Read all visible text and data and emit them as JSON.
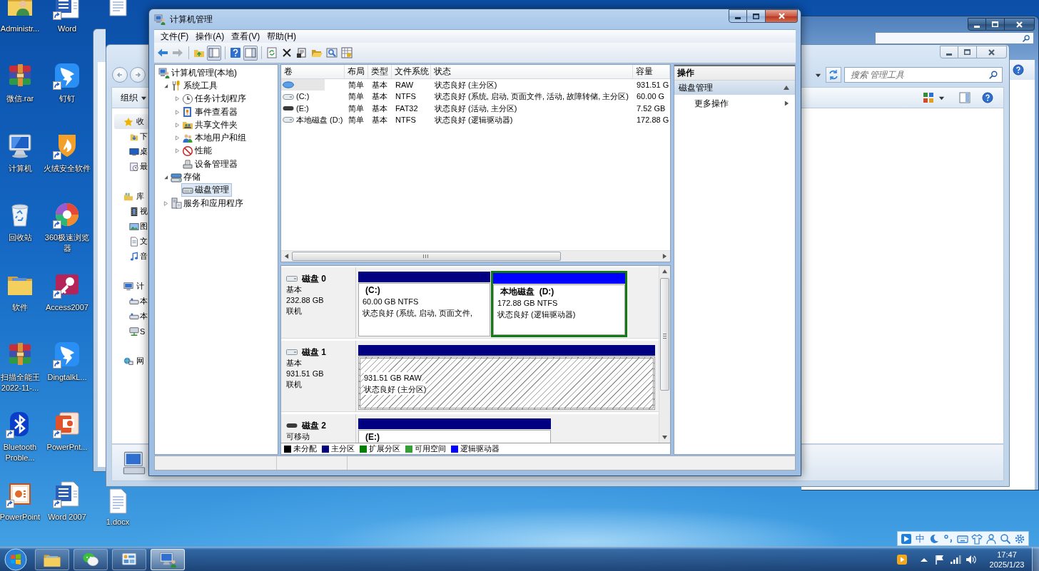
{
  "desktop": {
    "icons": [
      {
        "label": "Administr...",
        "kind": "user-folder",
        "shortcut": false
      },
      {
        "label": "Word",
        "kind": "word",
        "shortcut": true
      },
      {
        "label": "微信.rar",
        "kind": "archive",
        "shortcut": false
      },
      {
        "label": "钉钉",
        "kind": "dingtalk",
        "shortcut": true
      },
      {
        "label": "计算机",
        "kind": "computer",
        "shortcut": false
      },
      {
        "label": "火绒安全软件",
        "kind": "shield",
        "shortcut": true
      },
      {
        "label": "回收站",
        "kind": "recycle",
        "shortcut": false
      },
      {
        "label": "360极速浏览器",
        "kind": "browser",
        "shortcut": true
      },
      {
        "label": "软件",
        "kind": "folder",
        "shortcut": false
      },
      {
        "label": "Access2007",
        "kind": "access",
        "shortcut": true
      },
      {
        "label": "扫描全能王 2022-11-...",
        "kind": "archive",
        "shortcut": false
      },
      {
        "label": "DingtalkL...",
        "kind": "dingtalk",
        "shortcut": true
      },
      {
        "label": "Bluetooth Proble...",
        "kind": "bluetooth",
        "shortcut": true
      },
      {
        "label": "PowerPnt...",
        "kind": "powerpoint",
        "shortcut": true
      },
      {
        "label": "PowerPoint",
        "kind": "slides",
        "shortcut": true
      },
      {
        "label": "Word 2007",
        "kind": "word",
        "shortcut": true
      }
    ],
    "loose_icons": [
      {
        "kind": "document",
        "label": "1.docx",
        "shortcut": false
      },
      {
        "kind": "document",
        "shortcut": false
      }
    ]
  },
  "background_windows": {
    "explorer": {
      "toolbar_label": "组织",
      "search_placeholder": "搜索 管理工具",
      "nav_groups": [
        {
          "items": [
            {
              "label": "收",
              "kind": "favorites",
              "selected": true
            },
            {
              "label": "下",
              "kind": "downloads",
              "selected": false
            },
            {
              "label": "桌",
              "kind": "desktop",
              "selected": false
            },
            {
              "label": "最",
              "kind": "recent",
              "selected": false
            }
          ]
        },
        {
          "items": [
            {
              "label": "库",
              "kind": "library",
              "selected": false
            },
            {
              "label": "视",
              "kind": "video",
              "selected": false
            },
            {
              "label": "图",
              "kind": "pictures",
              "selected": false
            },
            {
              "label": "文",
              "kind": "documents",
              "selected": false
            },
            {
              "label": "音",
              "kind": "music",
              "selected": false
            }
          ]
        },
        {
          "items": [
            {
              "label": "计",
              "kind": "computer",
              "selected": false
            },
            {
              "label": "本",
              "kind": "drive",
              "selected": false
            },
            {
              "label": "本",
              "kind": "drive",
              "selected": false
            },
            {
              "label": "S",
              "kind": "network-drive",
              "selected": false
            }
          ]
        },
        {
          "items": [
            {
              "label": "网",
              "kind": "network",
              "selected": false
            }
          ]
        }
      ]
    }
  },
  "window": {
    "title": "计算机管理"
  },
  "menu": [
    "文件(F)",
    "操作(A)",
    "查看(V)",
    "帮助(H)"
  ],
  "toolbar": [
    [
      {
        "kind": "back",
        "pressed": false,
        "disabled": false
      },
      {
        "kind": "forward",
        "pressed": false,
        "disabled": true
      }
    ],
    [
      {
        "kind": "up",
        "pressed": false,
        "disabled": false
      },
      {
        "kind": "tree-toggle",
        "pressed": true,
        "disabled": false
      }
    ],
    [
      {
        "kind": "help",
        "pressed": false,
        "disabled": false
      },
      {
        "kind": "pane-toggle",
        "pressed": true,
        "disabled": false
      }
    ],
    [
      {
        "kind": "refresh",
        "pressed": false,
        "disabled": false
      },
      {
        "kind": "delete",
        "pressed": false,
        "disabled": false
      },
      {
        "kind": "properties",
        "pressed": false,
        "disabled": false
      },
      {
        "kind": "open",
        "pressed": false,
        "disabled": false
      },
      {
        "kind": "find",
        "pressed": false,
        "disabled": false
      },
      {
        "kind": "disk-settings",
        "pressed": false,
        "disabled": false
      }
    ]
  ],
  "tree": [
    {
      "label": "计算机管理(本地)",
      "kind": "console",
      "selected": false,
      "children": [
        {
          "label": "系统工具",
          "kind": "tools",
          "expandable": true,
          "expanded": true,
          "selected": false,
          "children": [
            {
              "label": "任务计划程序",
              "kind": "scheduler",
              "expandable": true,
              "expanded": false,
              "selected": false
            },
            {
              "label": "事件查看器",
              "kind": "events",
              "expandable": true,
              "expanded": false,
              "selected": false
            },
            {
              "label": "共享文件夹",
              "kind": "shares",
              "expandable": true,
              "expanded": false,
              "selected": false
            },
            {
              "label": "本地用户和组",
              "kind": "users",
              "expandable": true,
              "expanded": false,
              "selected": false
            },
            {
              "label": "性能",
              "kind": "performance",
              "expandable": true,
              "expanded": false,
              "selected": false
            },
            {
              "label": "设备管理器",
              "kind": "devices",
              "expandable": false,
              "expanded": false,
              "selected": false
            }
          ]
        },
        {
          "label": "存储",
          "kind": "storage",
          "expandable": true,
          "expanded": true,
          "selected": false,
          "children": [
            {
              "label": "磁盘管理",
              "kind": "disk",
              "expandable": false,
              "expanded": false,
              "selected": true
            }
          ]
        },
        {
          "label": "服务和应用程序",
          "kind": "services",
          "expandable": true,
          "expanded": false,
          "selected": false
        }
      ]
    }
  ],
  "volumes": {
    "columns": [
      "卷",
      "布局",
      "类型",
      "文件系统",
      "状态",
      "容量"
    ],
    "rows": [
      {
        "kind": "raw",
        "selected": true,
        "layout": "简单",
        "type": "基本",
        "file_system": "RAW",
        "status": "状态良好 (主分区)",
        "capacity": "931.51 G"
      },
      {
        "kind": "disk",
        "selected": false,
        "volume": "(C:)",
        "layout": "简单",
        "type": "基本",
        "file_system": "NTFS",
        "status": "状态良好 (系统, 启动, 页面文件, 活动, 故障转储, 主分区)",
        "capacity": "60.00 G"
      },
      {
        "kind": "removable",
        "selected": false,
        "volume": "(E:)",
        "layout": "简单",
        "type": "基本",
        "file_system": "FAT32",
        "status": "状态良好 (活动, 主分区)",
        "capacity": "7.52 GB"
      },
      {
        "kind": "disk",
        "selected": false,
        "volume": "本地磁盘 (D:)",
        "layout": "简单",
        "type": "基本",
        "file_system": "NTFS",
        "status": "状态良好 (逻辑驱动器)",
        "capacity": "172.88 G"
      }
    ]
  },
  "disks": [
    {
      "name": "磁盘 0",
      "kind": "fixed",
      "type": "基本",
      "size": "232.88 GB",
      "state": "联机",
      "partitions": [
        {
          "title": "(C:)",
          "size": "60.00 GB NTFS",
          "status": "状态良好 (系统, 启动, 页面文件,",
          "color": "#000080",
          "extended": false,
          "selected": false
        },
        {
          "title": "本地磁盘  (D:)",
          "size": "172.88 GB NTFS",
          "status": "状态良好 (逻辑驱动器)",
          "color": "#0000ff",
          "extended": true,
          "selected": false
        }
      ]
    },
    {
      "name": "磁盘 1",
      "kind": "fixed",
      "type": "基本",
      "size": "931.51 GB",
      "state": "联机",
      "partitions": [
        {
          "size": "931.51 GB RAW",
          "status": "状态良好 (主分区)",
          "color": "#000080",
          "extended": false,
          "selected": true
        }
      ]
    },
    {
      "name": "磁盘 2",
      "kind": "removable",
      "type": "可移动",
      "partitions": [
        {
          "title": "(E:)",
          "color": "#000080",
          "extended": false,
          "selected": false
        }
      ]
    }
  ],
  "legend": [
    {
      "label": "未分配",
      "color": "#000000"
    },
    {
      "label": "主分区",
      "color": "#000080"
    },
    {
      "label": "扩展分区",
      "color": "#008000"
    },
    {
      "label": "可用空间",
      "color": "#33a033"
    },
    {
      "label": "逻辑驱动器",
      "color": "#0000ff"
    }
  ],
  "actions": {
    "title": "操作",
    "sections": [
      {
        "title": "磁盘管理",
        "expanded": true,
        "items": [
          {
            "label": "更多操作",
            "submenu": true
          }
        ]
      }
    ]
  },
  "taskbar": {
    "buttons": [
      {
        "kind": "explorer",
        "active": false
      },
      {
        "kind": "wechat",
        "active": false
      },
      {
        "kind": "control-panel",
        "active": false
      },
      {
        "kind": "computer-management",
        "active": true
      }
    ],
    "clock": {
      "time": "17:47",
      "date": "2025/1/23"
    }
  },
  "ime_bar": {
    "mode": "中"
  }
}
